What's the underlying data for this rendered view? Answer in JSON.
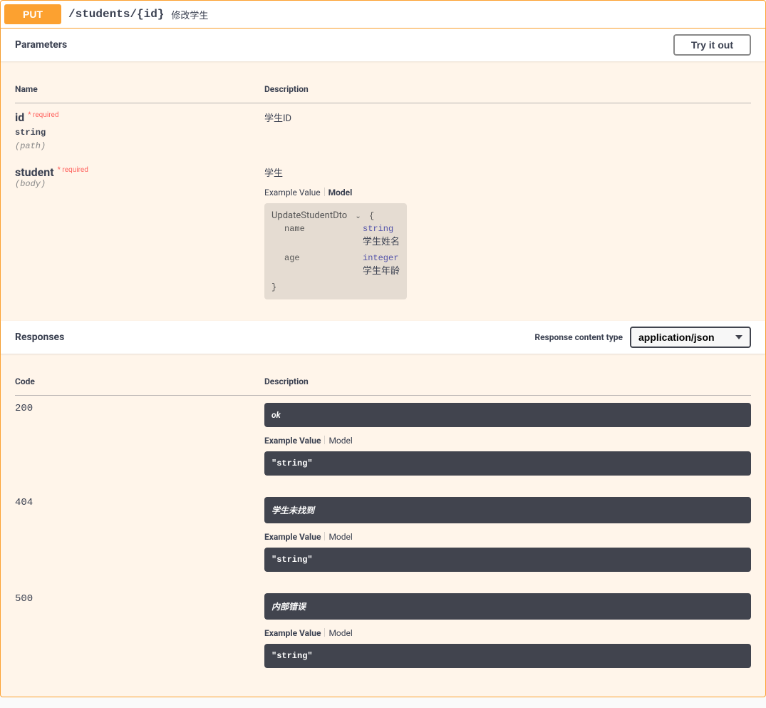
{
  "operation": {
    "method": "PUT",
    "path": "/students/{id}",
    "summary": "修改学生"
  },
  "sections": {
    "parameters_title": "Parameters",
    "try_it_out": "Try it out",
    "responses_title": "Responses",
    "content_type_label": "Response content type",
    "content_type_value": "application/json"
  },
  "param_headers": {
    "name": "Name",
    "description": "Description"
  },
  "params": [
    {
      "name": "id",
      "required_label": "* required",
      "type": "string",
      "in": "(path)",
      "description": "学生ID"
    },
    {
      "name": "student",
      "required_label": "* required",
      "type": "",
      "in": "(body)",
      "description": "学生"
    }
  ],
  "tabs": {
    "example_value": "Example Value",
    "model": "Model"
  },
  "model": {
    "title": "UpdateStudentDto",
    "open_brace": "{",
    "close_brace": "}",
    "props": [
      {
        "name": "name",
        "type": "string",
        "desc": "学生姓名"
      },
      {
        "name": "age",
        "type": "integer",
        "desc": "学生年龄"
      }
    ]
  },
  "response_headers": {
    "code": "Code",
    "description": "Description"
  },
  "responses": [
    {
      "code": "200",
      "desc": "ok",
      "example": ""
    },
    {
      "code": "404",
      "desc": "学生未找到",
      "example": "\"string\""
    },
    {
      "code": "500",
      "desc": "内部错误",
      "example": "\"string\""
    }
  ],
  "extra_example": "\"string\""
}
